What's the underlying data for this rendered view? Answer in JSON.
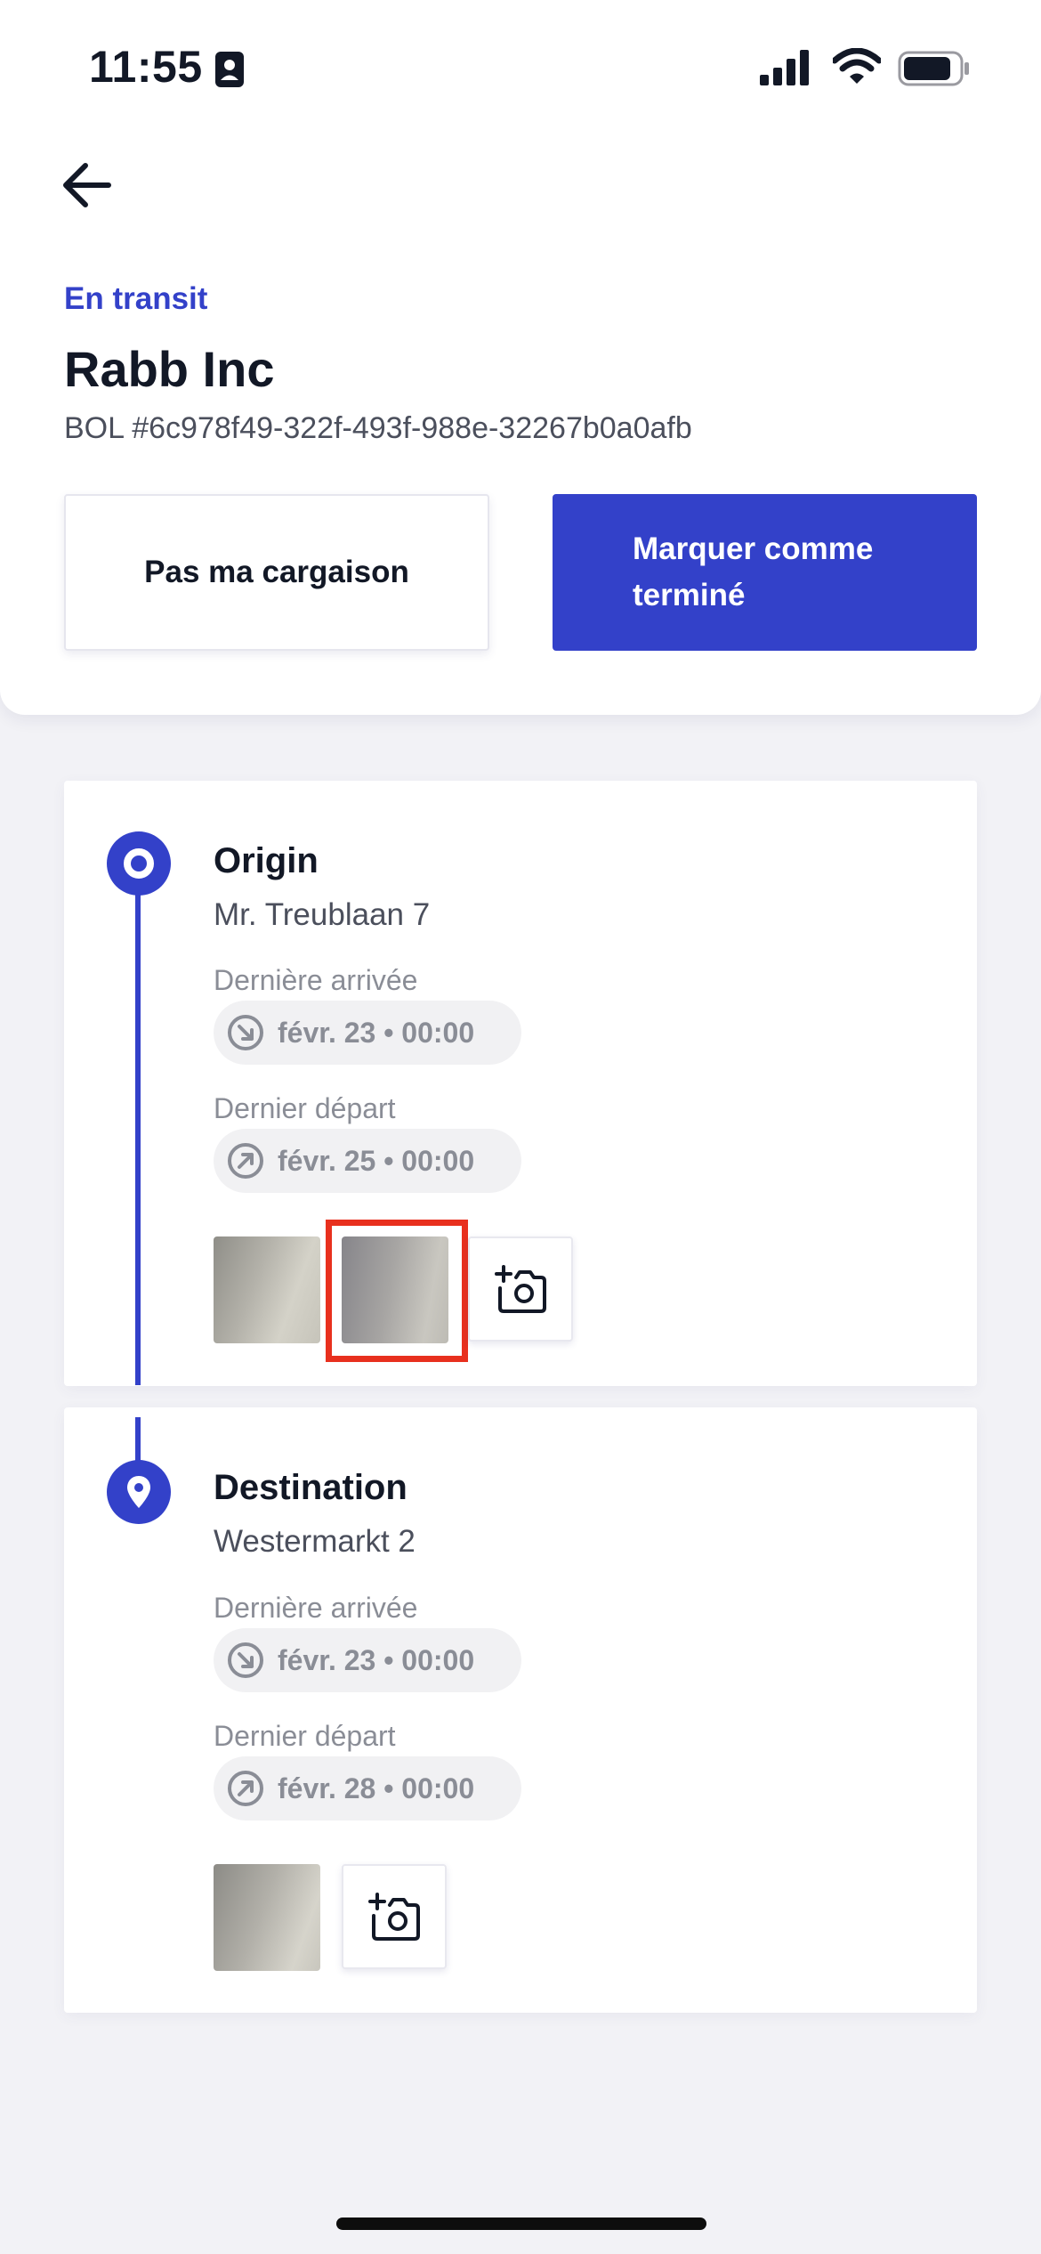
{
  "status_bar": {
    "time": "11:55"
  },
  "header": {
    "status": "En transit",
    "title": "Rabb Inc",
    "bol": "BOL #6c978f49-322f-493f-988e-32267b0a0afb"
  },
  "actions": {
    "not_my_load": "Pas ma cargaison",
    "mark_complete": "Marquer comme terminé"
  },
  "stops": [
    {
      "name": "Origin",
      "address": "Mr. Treublaan 7",
      "arrival_label": "Dernière arrivée",
      "arrival_value": "févr. 23 • 00:00",
      "departure_label": "Dernier départ",
      "departure_value": "févr. 25 • 00:00",
      "photo_count": 2
    },
    {
      "name": "Destination",
      "address": "Westermarkt 2",
      "arrival_label": "Dernière arrivée",
      "arrival_value": "févr. 23 • 00:00",
      "departure_label": "Dernier départ",
      "departure_value": "févr. 28 • 00:00",
      "photo_count": 1
    }
  ],
  "colors": {
    "accent": "#3341c9",
    "highlight": "#e8301e",
    "background": "#f2f2f6"
  },
  "icons": [
    "badge-icon",
    "signal-icon",
    "wifi-icon",
    "battery-icon",
    "back-arrow-icon",
    "origin-ring-icon",
    "location-pin-icon",
    "arrival-arrow-icon",
    "departure-arrow-icon",
    "add-photo-camera-icon"
  ]
}
